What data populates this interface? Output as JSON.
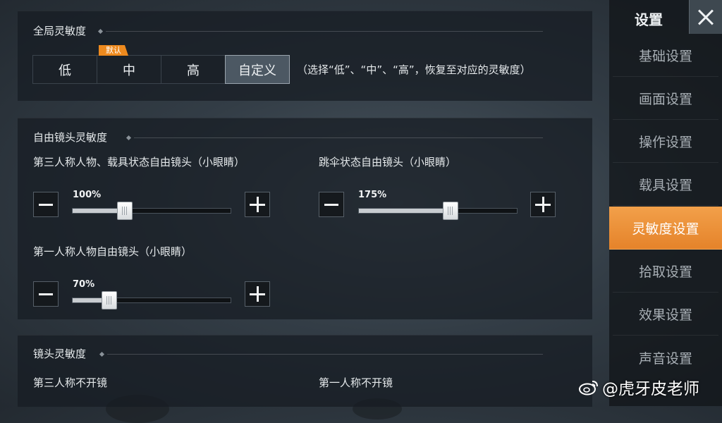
{
  "global_sensitivity": {
    "title": "全局灵敏度",
    "options": [
      "低",
      "中",
      "高",
      "自定义"
    ],
    "default_badge": "默认",
    "selected": "自定义",
    "hint": "（选择“低”、“中”、“高”，恢复至对应的灵敏度）"
  },
  "free_look": {
    "title": "自由镜头灵敏度",
    "sliders": [
      {
        "label": "第三人称人物、载具状态自由镜头（小眼睛）",
        "value_text": "100%",
        "fill": 0.33
      },
      {
        "label": "跳伞状态自由镜头（小眼睛）",
        "value_text": "175%",
        "fill": 0.58
      },
      {
        "label": "第一人称人物自由镜头（小眼睛）",
        "value_text": "70%",
        "fill": 0.23
      }
    ]
  },
  "camera_sensitivity": {
    "title": "镜头灵敏度",
    "items": [
      "第三人称不开镜",
      "第一人称不开镜"
    ]
  },
  "sidebar": {
    "title": "设置",
    "items": [
      "基础设置",
      "画面设置",
      "操作设置",
      "载具设置",
      "灵敏度设置",
      "拾取设置",
      "效果设置",
      "声音设置"
    ],
    "active": "灵敏度设置"
  },
  "watermark": {
    "text": "@虎牙皮老师",
    "icon": "weibo-icon"
  },
  "colors": {
    "accent": "#ee8a1e",
    "active_tab": "#e5832a"
  }
}
